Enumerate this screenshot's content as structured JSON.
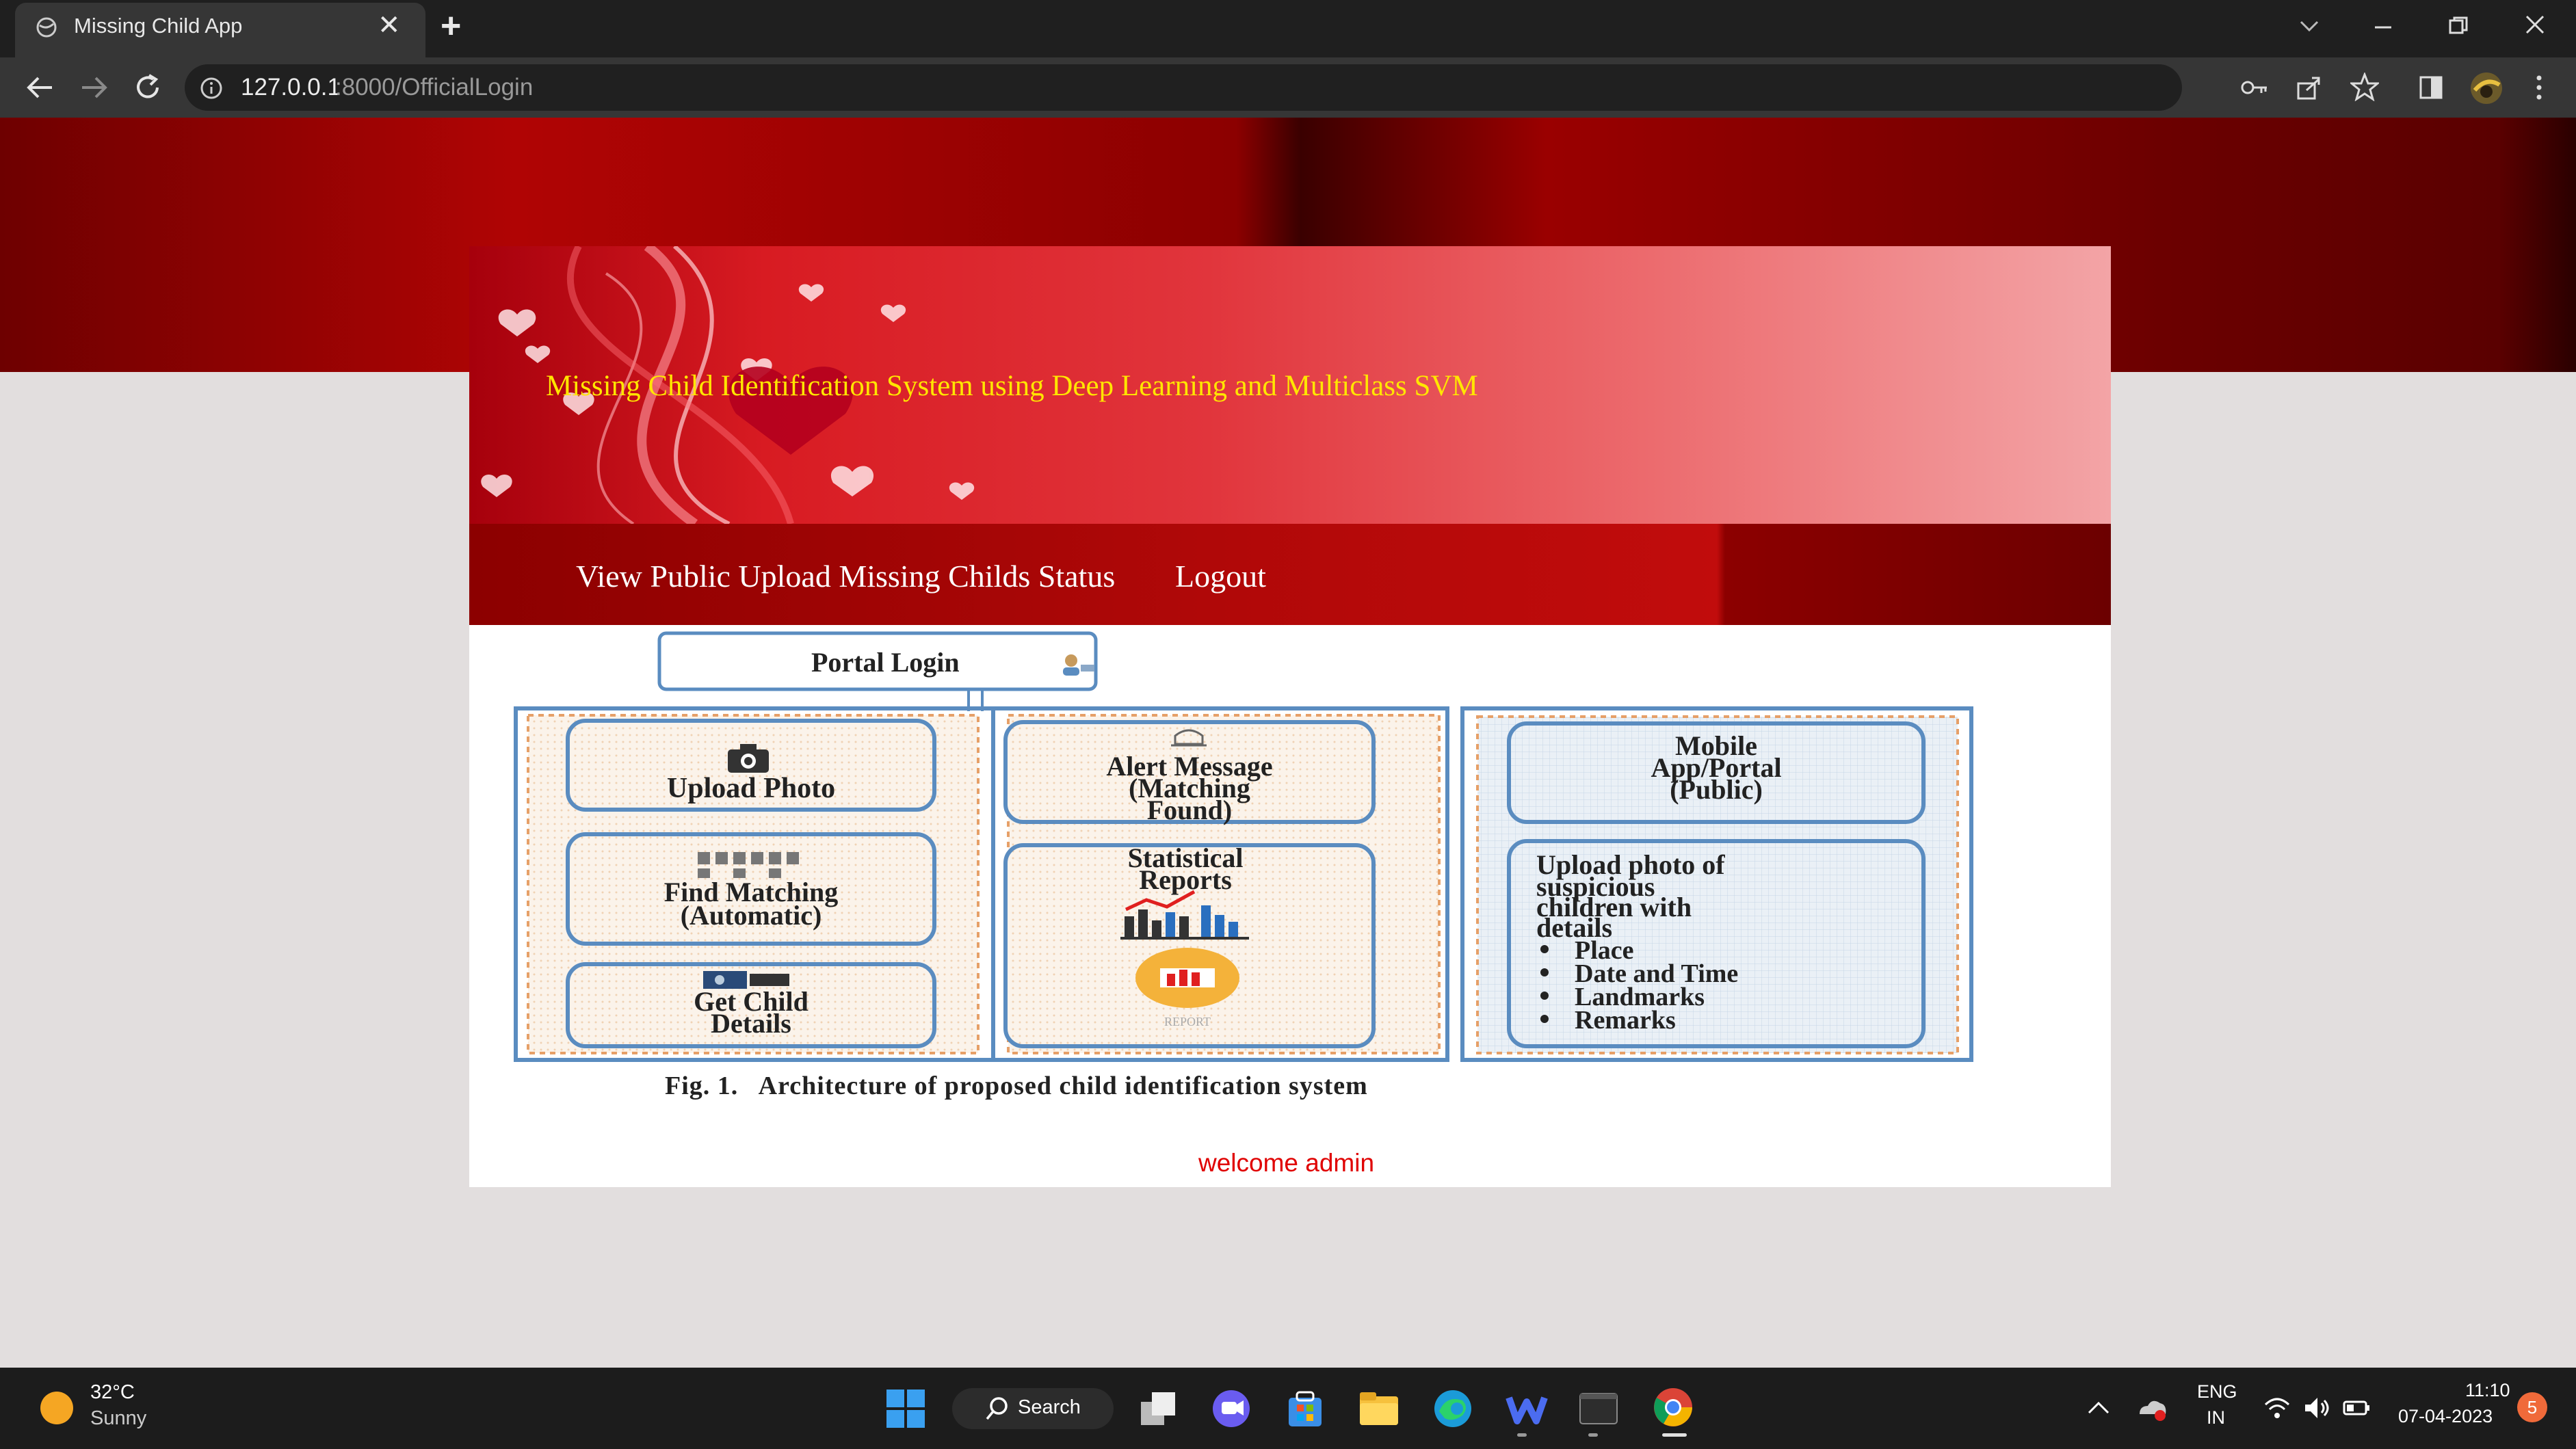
{
  "browser": {
    "tab_title": "Missing Child App",
    "close_tab_glyph": "✕",
    "new_tab_glyph": "+",
    "url_host": "127.0.0.1",
    "url_path": ":8000/OfficialLogin"
  },
  "page": {
    "banner_title": "Missing Child Identification System using Deep Learning and Multiclass SVM",
    "nav": {
      "view_status": "View Public Upload Missing Childs Status",
      "logout": "Logout"
    },
    "figure": {
      "portal_login": "Portal Login",
      "upload_photo": "Upload Photo",
      "find_matching": [
        "Find Matching",
        "(Automatic)"
      ],
      "get_child_details": [
        "Get Child",
        "Details"
      ],
      "alert_message": [
        "Alert Message",
        "(Matching",
        "Found)"
      ],
      "statistical_reports": [
        "Statistical",
        "Reports"
      ],
      "report_label": "REPORT",
      "mobile_app": [
        "Mobile",
        "App/Portal",
        "(Public)"
      ],
      "upload_suspicious": [
        "Upload photo of",
        "suspicious",
        "children with",
        "details"
      ],
      "bullets": [
        "Place",
        "Date and Time",
        "Landmarks",
        "Remarks"
      ]
    },
    "caption": "Fig. 1.   Architecture of proposed child identification system",
    "welcome": "welcome admin"
  },
  "taskbar": {
    "weather_temp": "32°C",
    "weather_desc": "Sunny",
    "search_label": "Search",
    "lang_top": "ENG",
    "lang_bottom": "IN",
    "time": "11:10",
    "date": "07-04-2023",
    "notification_count": "5"
  },
  "colors": {
    "title_yellow": "#ffe600",
    "welcome_red": "#e00000",
    "nav_red": "#b00808"
  }
}
